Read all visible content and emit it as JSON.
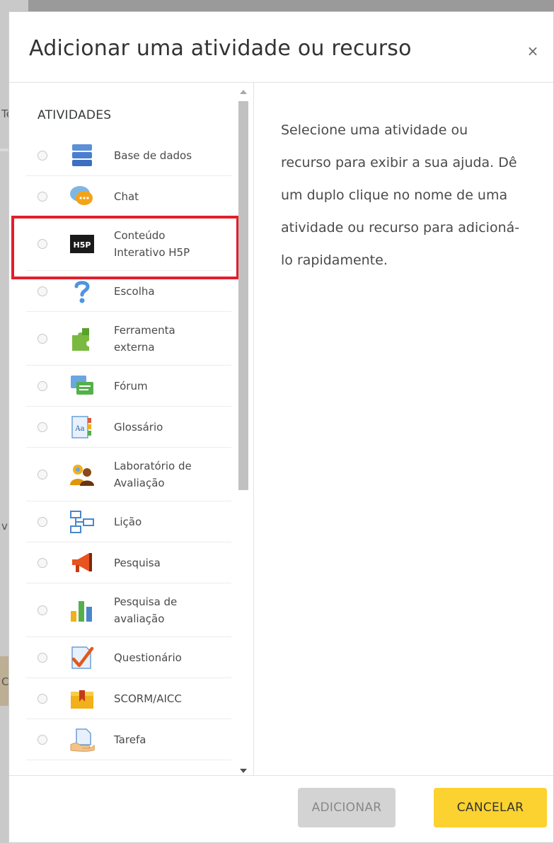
{
  "modal": {
    "title": "Adicionar uma atividade ou recurso",
    "close_label": "×"
  },
  "chooser": {
    "section_title": "ATIVIDADES",
    "items": [
      {
        "label": "Base de dados",
        "icon": "database-icon"
      },
      {
        "label": "Chat",
        "icon": "chat-icon"
      },
      {
        "label": "Conteúdo Interativo H5P",
        "icon": "h5p-icon"
      },
      {
        "label": "Escolha",
        "icon": "question-icon"
      },
      {
        "label": "Ferramenta externa",
        "icon": "puzzle-icon"
      },
      {
        "label": "Fórum",
        "icon": "forum-icon"
      },
      {
        "label": "Glossário",
        "icon": "glossary-icon"
      },
      {
        "label": "Laboratório de Avaliação",
        "icon": "workshop-icon"
      },
      {
        "label": "Lição",
        "icon": "lesson-icon"
      },
      {
        "label": "Pesquisa",
        "icon": "megaphone-icon"
      },
      {
        "label": "Pesquisa de avaliação",
        "icon": "bar-chart-icon"
      },
      {
        "label": "Questionário",
        "icon": "quiz-icon"
      },
      {
        "label": "SCORM/AICC",
        "icon": "scorm-icon"
      },
      {
        "label": "Tarefa",
        "icon": "assignment-icon"
      }
    ]
  },
  "help": {
    "text": "Selecione uma atividade ou recurso para exibir a sua ajuda. Dê um duplo clique no nome de uma atividade ou recurso para adicioná-lo rapidamente."
  },
  "footer": {
    "add_label": "ADICIONAR",
    "cancel_label": "CANCELAR"
  },
  "background": {
    "fragments": [
      "Te",
      "v",
      "C"
    ]
  },
  "colors": {
    "highlight": "#e21e2b",
    "cancel_button": "#fbd22f",
    "add_button_disabled": "#d3d3d3"
  }
}
